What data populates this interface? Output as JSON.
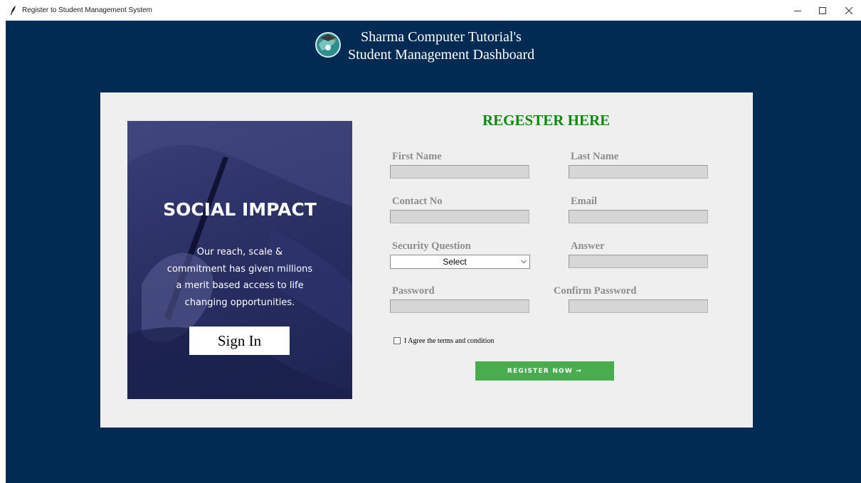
{
  "window": {
    "title": "Register to Student Management System",
    "controls": {
      "minimize": "minimize-icon",
      "maximize": "maximize-icon",
      "close": "close-icon"
    }
  },
  "header": {
    "line1": "Sharma Computer Tutorial's",
    "line2": "Student Management Dashboard",
    "logo_icon": "graduation-globe-icon"
  },
  "promo": {
    "title": "SOCIAL IMPACT",
    "lines": [
      "Our reach, scale &",
      "commitment has given millions",
      "a merit based access to life",
      "changing opportunities."
    ],
    "signin_label": "Sign In"
  },
  "form": {
    "title": "REGESTER HERE",
    "first_name": {
      "label": "First Name",
      "value": ""
    },
    "last_name": {
      "label": "Last Name",
      "value": ""
    },
    "contact": {
      "label": "Contact No",
      "value": ""
    },
    "email": {
      "label": "Email",
      "value": ""
    },
    "security_question": {
      "label": "Security Question",
      "selected": "Select"
    },
    "answer": {
      "label": "Answer",
      "value": ""
    },
    "password": {
      "label": "Password",
      "value": ""
    },
    "confirm_password": {
      "label": "Confirm Password",
      "value": ""
    },
    "agree_label": "I Agree the terms and condition",
    "agree_checked": false,
    "register_label": "REGISTER NOW →"
  },
  "colors": {
    "background": "#022b53",
    "card": "#efefef",
    "title_green": "#0a8a0a",
    "register_button": "#49ac4e",
    "label_gray": "#8c8c8c",
    "input_gray": "#d6d6d6"
  }
}
